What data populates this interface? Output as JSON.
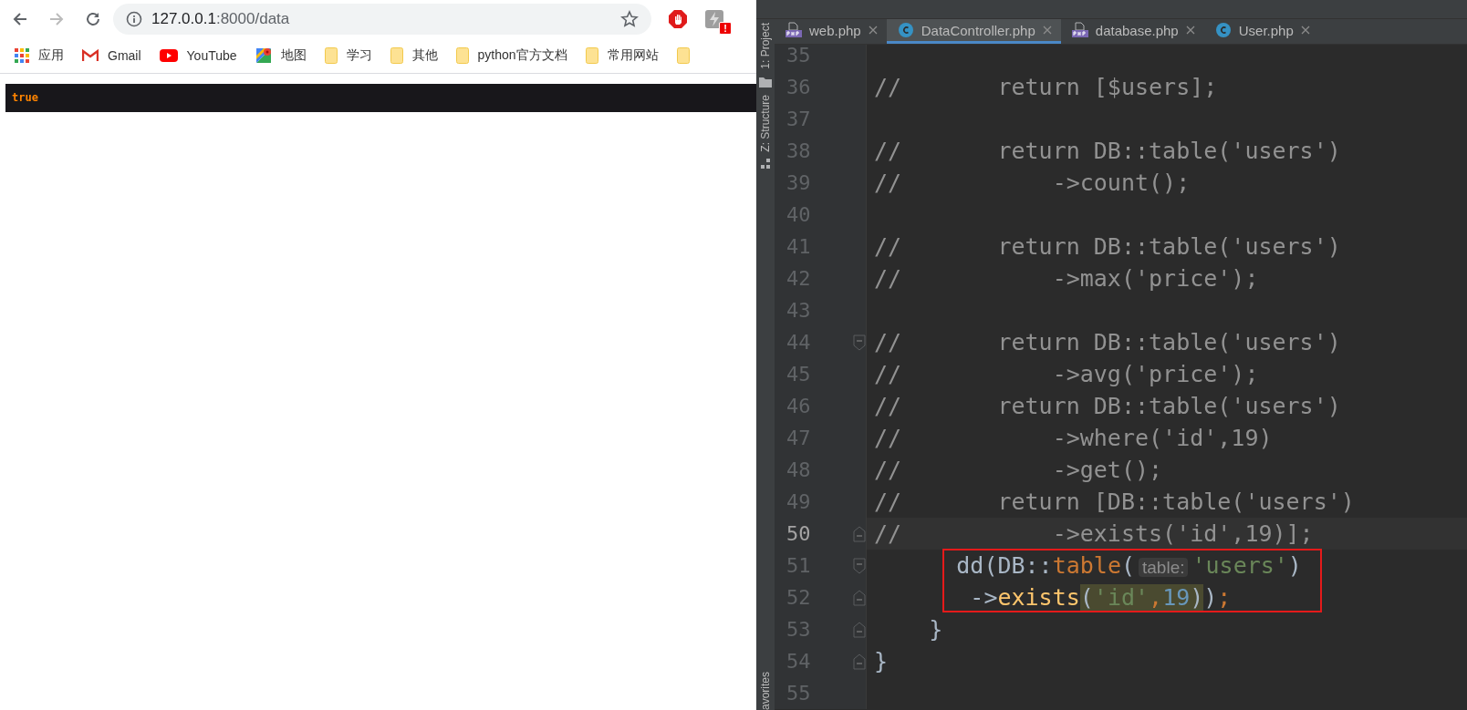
{
  "browser": {
    "nav": {
      "back_disabled": false,
      "forward_disabled": true
    },
    "address": {
      "host": "127.0.0.1",
      "path": ":8000/data"
    },
    "extension_badge": "!",
    "bookmarks": [
      {
        "kind": "apps",
        "label": "应用"
      },
      {
        "kind": "gmail",
        "label": "Gmail"
      },
      {
        "kind": "youtube",
        "label": "YouTube"
      },
      {
        "kind": "maps",
        "label": "地图"
      },
      {
        "kind": "folder",
        "label": "学习"
      },
      {
        "kind": "folder",
        "label": "其他"
      },
      {
        "kind": "folder",
        "label": "python官方文档"
      },
      {
        "kind": "folder",
        "label": "常用网站"
      },
      {
        "kind": "folder"
      }
    ],
    "page_output": "true"
  },
  "ide": {
    "tool_windows": [
      {
        "kind": "project",
        "label": "1: Project"
      },
      {
        "kind": "structure",
        "label": "Z: Structure"
      },
      {
        "kind": "favorites",
        "label": "avorites"
      }
    ],
    "tabs": [
      {
        "label": "web.php",
        "kind": "php",
        "selected": false
      },
      {
        "label": "DataController.php",
        "kind": "class",
        "selected": true
      },
      {
        "label": "database.php",
        "kind": "php",
        "selected": false
      },
      {
        "label": "User.php",
        "kind": "class",
        "selected": false
      }
    ],
    "lines": [
      {
        "number": "35",
        "current": false,
        "fold_start": false,
        "fold_end": false
      },
      {
        "number": "36",
        "current": false,
        "fold_start": false,
        "fold_end": false,
        "tokens": [
          {
            "text": "//       return [$users];",
            "kind": "comment",
            "matched": false
          }
        ]
      },
      {
        "number": "37",
        "current": false,
        "fold_start": false,
        "fold_end": false
      },
      {
        "number": "38",
        "current": false,
        "fold_start": false,
        "fold_end": false,
        "tokens": [
          {
            "text": "//       return DB::table('users')",
            "kind": "comment",
            "matched": false
          }
        ]
      },
      {
        "number": "39",
        "current": false,
        "fold_start": false,
        "fold_end": false,
        "tokens": [
          {
            "text": "//           ->count();",
            "kind": "comment",
            "matched": false
          }
        ]
      },
      {
        "number": "40",
        "current": false,
        "fold_start": false,
        "fold_end": false
      },
      {
        "number": "41",
        "current": false,
        "fold_start": false,
        "fold_end": false,
        "tokens": [
          {
            "text": "//       return DB::table('users')",
            "kind": "comment",
            "matched": false
          }
        ]
      },
      {
        "number": "42",
        "current": false,
        "fold_start": false,
        "fold_end": false,
        "tokens": [
          {
            "text": "//           ->max('price');",
            "kind": "comment",
            "matched": false
          }
        ]
      },
      {
        "number": "43",
        "current": false,
        "fold_start": false,
        "fold_end": false
      },
      {
        "number": "44",
        "current": false,
        "fold_start": true,
        "fold_end": false,
        "tokens": [
          {
            "text": "//       return DB::table('users')",
            "kind": "comment",
            "matched": false
          }
        ]
      },
      {
        "number": "45",
        "current": false,
        "fold_start": false,
        "fold_end": false,
        "tokens": [
          {
            "text": "//           ->avg('price');",
            "kind": "comment",
            "matched": false
          }
        ]
      },
      {
        "number": "46",
        "current": false,
        "fold_start": false,
        "fold_end": false,
        "tokens": [
          {
            "text": "//       return DB::table('users')",
            "kind": "comment",
            "matched": false
          }
        ]
      },
      {
        "number": "47",
        "current": false,
        "fold_start": false,
        "fold_end": false,
        "tokens": [
          {
            "text": "//           ->where('id',19)",
            "kind": "comment",
            "matched": false
          }
        ]
      },
      {
        "number": "48",
        "current": false,
        "fold_start": false,
        "fold_end": false,
        "tokens": [
          {
            "text": "//           ->get();",
            "kind": "comment",
            "matched": false
          }
        ]
      },
      {
        "number": "49",
        "current": false,
        "fold_start": false,
        "fold_end": false,
        "tokens": [
          {
            "text": "//       return [DB::table('users')",
            "kind": "comment",
            "matched": false
          }
        ]
      },
      {
        "number": "50",
        "current": true,
        "fold_start": false,
        "fold_end": true,
        "tokens": [
          {
            "text": "//           ->exists('id',19)];",
            "kind": "comment",
            "matched": false
          }
        ]
      },
      {
        "number": "51",
        "current": false,
        "fold_start": true,
        "fold_end": false,
        "tokens": [
          {
            "text": "      dd(DB::",
            "kind": "plain",
            "matched": false
          },
          {
            "text": "table",
            "kind": "static",
            "matched": false
          },
          {
            "text": "(",
            "kind": "plain",
            "matched": false
          },
          {
            "text": "table:",
            "kind": "hint",
            "matched": false
          },
          {
            "text": "'users'",
            "kind": "string",
            "matched": false
          },
          {
            "text": ")",
            "kind": "plain",
            "matched": false
          }
        ]
      },
      {
        "number": "52",
        "current": false,
        "fold_start": false,
        "fold_end": true,
        "tokens": [
          {
            "text": "       ->",
            "kind": "plain",
            "matched": false
          },
          {
            "text": "exists",
            "kind": "call",
            "matched": false
          },
          {
            "text": "(",
            "kind": "plain",
            "matched": true
          },
          {
            "text": "'id'",
            "kind": "string",
            "matched": true
          },
          {
            "text": ",",
            "kind": "punct",
            "matched": true
          },
          {
            "text": "19",
            "kind": "number",
            "matched": true
          },
          {
            "text": ")",
            "kind": "plain",
            "matched": true
          },
          {
            "text": ")",
            "kind": "plain",
            "matched": false
          },
          {
            "text": ";",
            "kind": "punct",
            "matched": false
          }
        ]
      },
      {
        "number": "53",
        "current": false,
        "fold_start": false,
        "fold_end": true,
        "tokens": [
          {
            "text": "    }",
            "kind": "plain",
            "matched": false
          }
        ]
      },
      {
        "number": "54",
        "current": false,
        "fold_start": false,
        "fold_end": true,
        "tokens": [
          {
            "text": "}",
            "kind": "plain",
            "matched": false
          }
        ]
      },
      {
        "number": "55",
        "current": false,
        "fold_start": false,
        "fold_end": false
      }
    ]
  }
}
